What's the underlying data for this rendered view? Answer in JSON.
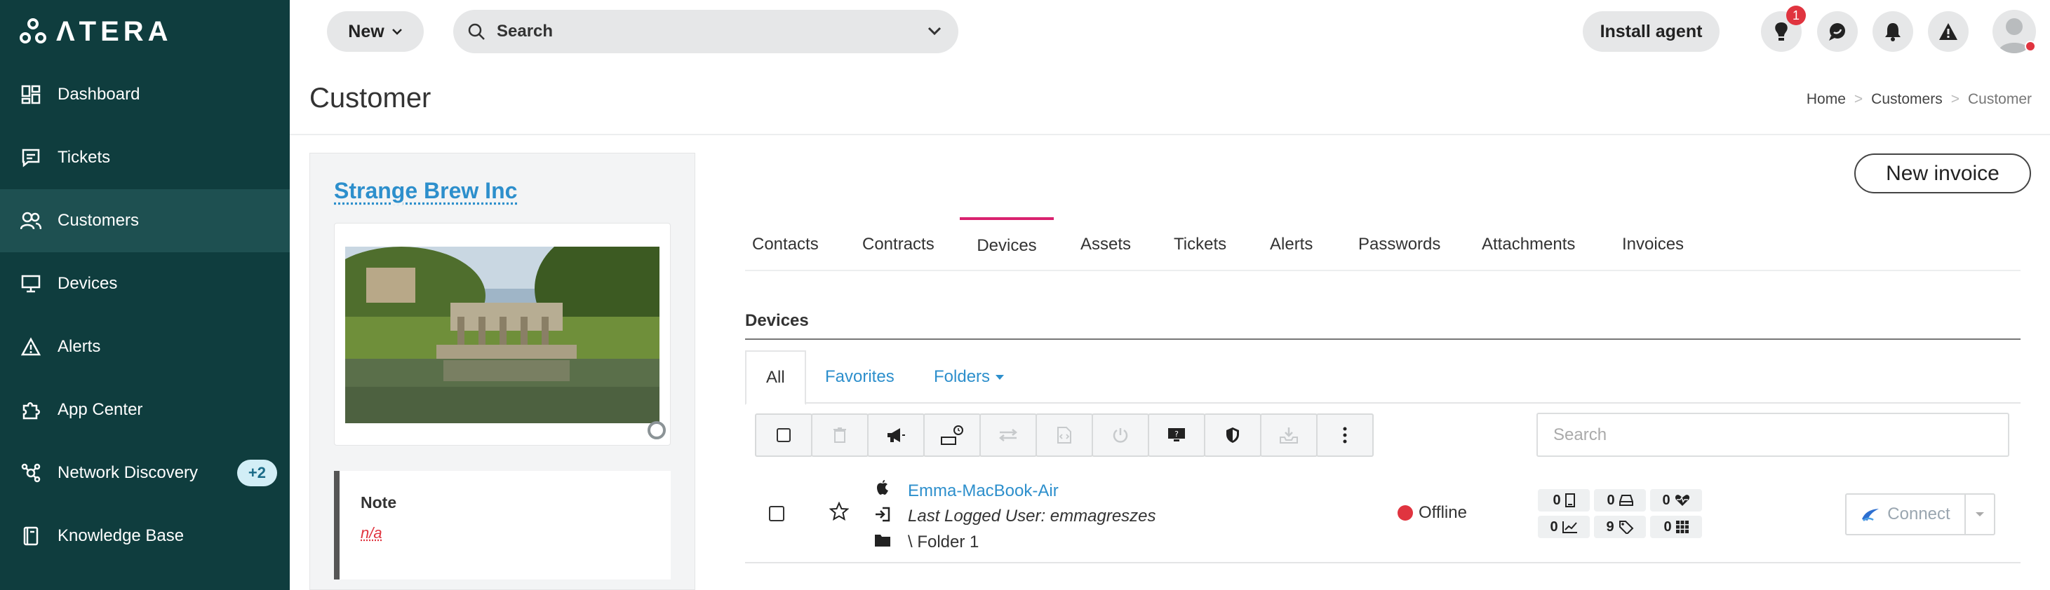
{
  "brand": {
    "name": "ΛTERA"
  },
  "sidebar": {
    "items": [
      {
        "label": "Dashboard",
        "icon": "dashboard-icon"
      },
      {
        "label": "Tickets",
        "icon": "ticket-icon"
      },
      {
        "label": "Customers",
        "icon": "customers-icon",
        "active": true
      },
      {
        "label": "Devices",
        "icon": "monitor-icon"
      },
      {
        "label": "Alerts",
        "icon": "alert-triangle-icon"
      },
      {
        "label": "App Center",
        "icon": "puzzle-icon"
      },
      {
        "label": "Network Discovery",
        "icon": "network-icon",
        "badge": "+2"
      },
      {
        "label": "Knowledge Base",
        "icon": "book-icon"
      }
    ]
  },
  "topbar": {
    "new_label": "New",
    "search_label": "Search",
    "install_label": "Install agent",
    "notification_count": "1"
  },
  "page": {
    "title": "Customer",
    "breadcrumb": [
      "Home",
      "Customers",
      "Customer"
    ]
  },
  "customer": {
    "name": "Strange Brew Inc",
    "note_label": "Note",
    "note_value": "n/a"
  },
  "actions": {
    "new_invoice": "New invoice"
  },
  "tabs": [
    {
      "label": "Contacts"
    },
    {
      "label": "Contracts"
    },
    {
      "label": "Devices",
      "active": true
    },
    {
      "label": "Assets"
    },
    {
      "label": "Tickets"
    },
    {
      "label": "Alerts"
    },
    {
      "label": "Passwords"
    },
    {
      "label": "Attachments"
    },
    {
      "label": "Invoices"
    }
  ],
  "devices": {
    "section_label": "Devices",
    "subtabs": {
      "all": "All",
      "favorites": "Favorites",
      "folders": "Folders"
    },
    "search_placeholder": "Search",
    "rows": [
      {
        "name": "Emma-MacBook-Air",
        "last_user": "Last Logged User: emmagreszes",
        "folder": "\\ Folder 1",
        "status": "Offline",
        "counters": [
          "0",
          "0",
          "0",
          "0",
          "9",
          "0"
        ],
        "connect_label": "Connect"
      }
    ]
  },
  "colors": {
    "sidebar": "#0f3d3e",
    "accent_tab": "#d9226f",
    "link": "#2d8fcc",
    "offline": "#e0343f"
  }
}
